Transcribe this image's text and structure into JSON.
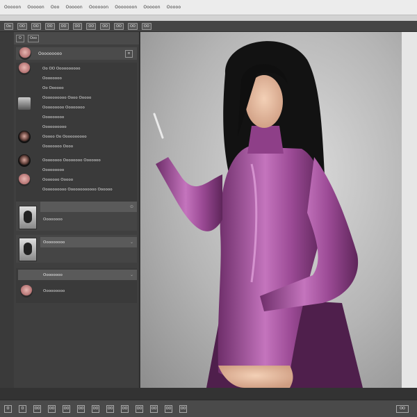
{
  "menubar": {
    "items": [
      "Ooooon",
      "Ooooon",
      "Ooo",
      "Ooooon",
      "Oooooon",
      "Ooooooon",
      "Ooooon",
      "Ooooo"
    ]
  },
  "toolbar": {
    "buttons": [
      "Oo",
      "OO",
      "OO",
      "OO",
      "OO",
      "OO",
      "OO",
      "OO",
      "OO",
      "OO",
      "OO"
    ]
  },
  "panel": {
    "tabs": [
      "O",
      "Ooo"
    ],
    "header_label": "Ooooooooo",
    "rows": [
      "Oo OO Oooooooooo",
      "Oooooooo",
      "Oo Oooooo",
      "Oooooooooo Oooo Ooooo",
      "Ooooooooo Oooooooo",
      "Ooooooooo",
      "Oooooooooo",
      "Ooooo Oo Oooooooooo",
      "Oooooooo Oooo",
      "Oooooooo Oooooooo Ooooooo",
      "Ooooooooo",
      "Ooooooo Ooooo",
      "Oooooooooo Oooooooooooo Oooooo"
    ],
    "sections": [
      {
        "label": "Oooooooo"
      },
      {
        "label": "Ooooooooo"
      },
      {
        "label": "Oooooooo"
      },
      {
        "label": "Ooooooooo"
      }
    ]
  },
  "bottombar": {
    "buttons": [
      "O",
      "O",
      "OO",
      "OO",
      "OO",
      "OO",
      "OO",
      "OO",
      "OO",
      "OO",
      "OO",
      "OO",
      "OO",
      "OO"
    ]
  },
  "colors": {
    "suit": "#9b4a95",
    "suit_highlight": "#d68dd0",
    "hair": "#121212",
    "skin": "#e9c0a3"
  }
}
